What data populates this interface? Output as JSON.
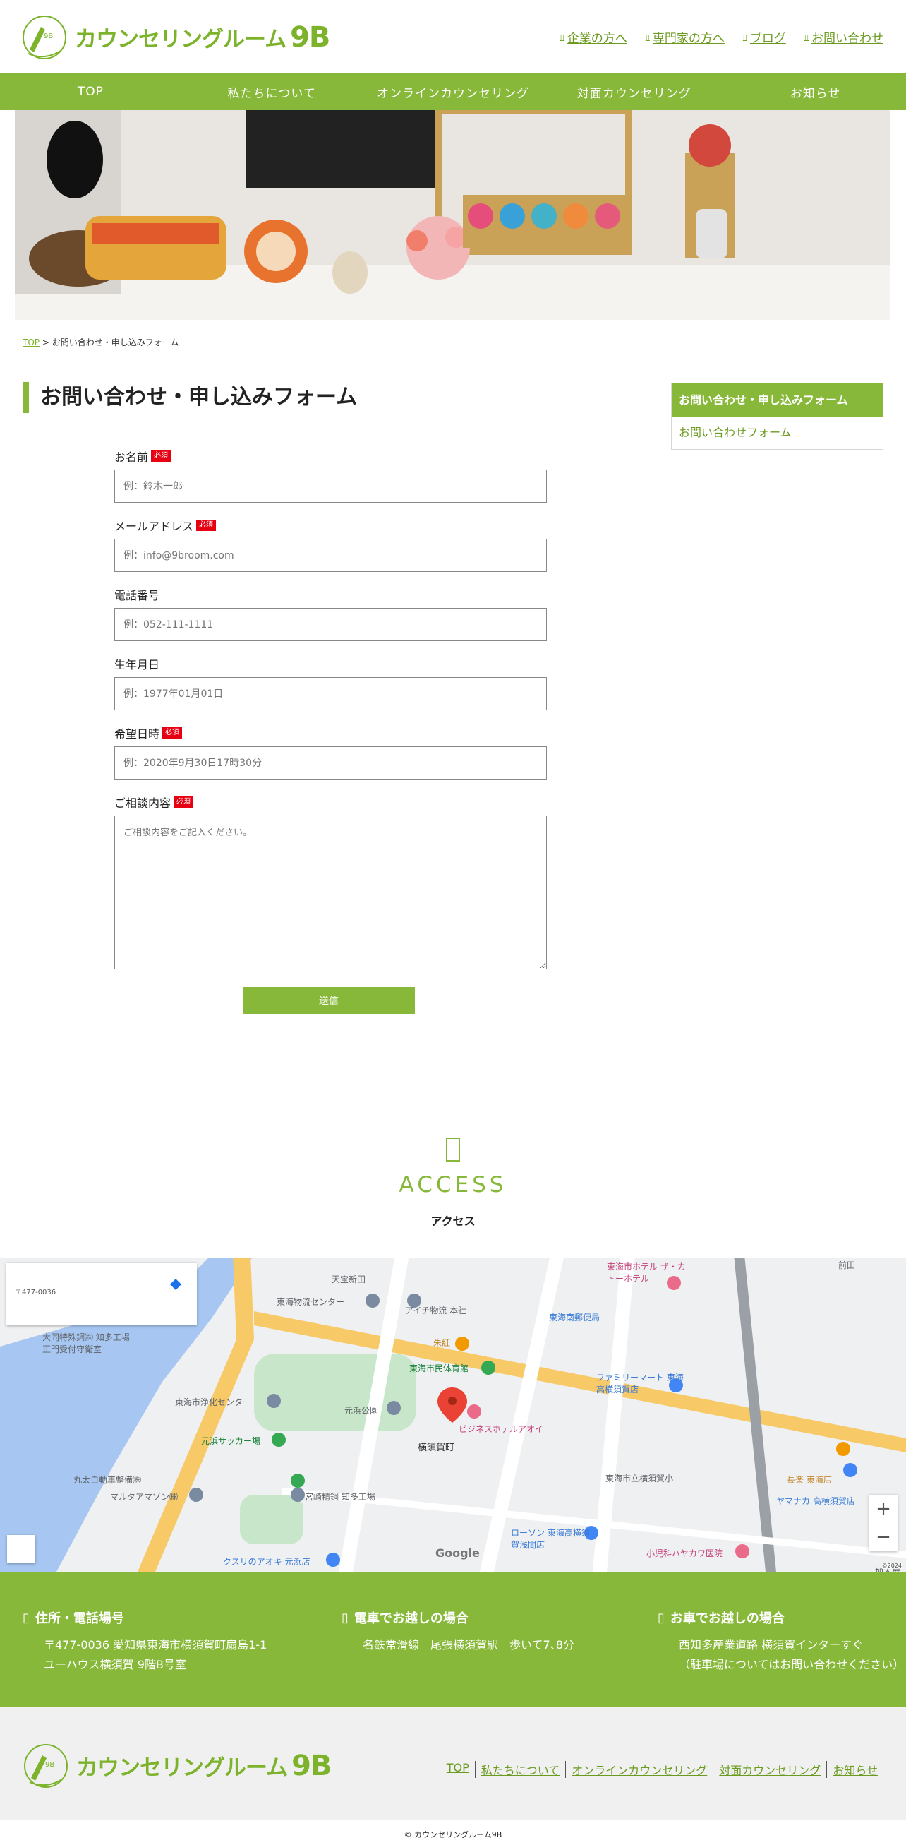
{
  "header": {
    "logo_text": "カウンセリングルーム",
    "logo_num": "9B",
    "top_links": [
      "企業の方へ",
      "専門家の方へ",
      "ブログ",
      "お問い合わせ"
    ]
  },
  "nav": [
    "TOP",
    "私たちについて",
    "オンラインカウンセリング",
    "対面カウンセリング",
    "お知らせ"
  ],
  "breadcrumb": {
    "home": "TOP",
    "sep": " > ",
    "current": "お問い合わせ・申し込みフォーム"
  },
  "page_title": "お問い合わせ・申し込みフォーム",
  "side": {
    "heading": "お問い合わせ・申し込みフォーム",
    "item": "お問い合わせフォーム"
  },
  "form": {
    "required_badge": "必須",
    "fields": [
      {
        "label": "お名前",
        "placeholder": "例：鈴木一郎",
        "required": true
      },
      {
        "label": "メールアドレス",
        "placeholder": "例：info@9broom.com",
        "required": true
      },
      {
        "label": "電話番号",
        "placeholder": "例：052-111-1111",
        "required": false
      },
      {
        "label": "生年月日",
        "placeholder": "例：1977年01月01日",
        "required": false
      },
      {
        "label": "希望日時",
        "placeholder": "例：2020年9月30日17時30分",
        "required": true
      },
      {
        "label": "ご相談内容",
        "placeholder": "ご相談内容をご記入ください。",
        "required": true
      }
    ],
    "submit": "送信"
  },
  "access": {
    "en": "ACCESS",
    "jp": "アクセス"
  },
  "map": {
    "card_address": "〒477-0036 ",
    "zoom_in": "+",
    "zoom_out": "−",
    "google": "Google",
    "footer_text": "©2024",
    "labels": [
      "天宝新田",
      "東海物流センター",
      "アイチ物流 本社",
      "東海南郵便局",
      "朱紅",
      "東海市民体育館",
      "ファミリーマート 東海高横須賀店",
      "東海市浄化センター",
      "元浜公園",
      "元浜サッカー場",
      "ビジネスホテルアオイ",
      "横須賀町",
      "宮崎精鋼 知多工場",
      "丸太自動車整備㈱",
      "マルタアマゾン㈱",
      "ローソン 東海高横須賀浅間店",
      "東海市立横須賀小",
      "長楽 東海店",
      "ヤマナカ 高横須賀店",
      "小児科ハヤカワ医院",
      "東海市ホテル ザ・カトーホテル",
      "大同特殊鋼㈱ 知多工場 正門受付守衛室",
      "クスリのアオキ 元浜店",
      "前田",
      "加木屋"
    ]
  },
  "info": [
    {
      "title": "住所・電話場号",
      "lines": [
        "〒477-0036 愛知県東海市横須賀町扇島1-1",
        "ユーハウス横須賀 9階B号室"
      ]
    },
    {
      "title": "電車でお越しの場合",
      "lines": [
        "名鉄常滑線　尾張横須賀駅　歩いて7､8分"
      ]
    },
    {
      "title": "お車でお越しの場合",
      "lines": [
        "西知多産業道路 横須賀インターすぐ",
        "（駐車場についてはお問い合わせください）"
      ]
    }
  ],
  "footer": {
    "links": [
      "TOP",
      "私たちについて",
      "オンラインカウンセリング",
      "対面カウンセリング",
      "お知らせ"
    ],
    "copyright": "© カウンセリングルーム9B"
  },
  "colors": {
    "accent": "#88b83a",
    "link": "#6a9a1e",
    "required": "#e60012"
  }
}
